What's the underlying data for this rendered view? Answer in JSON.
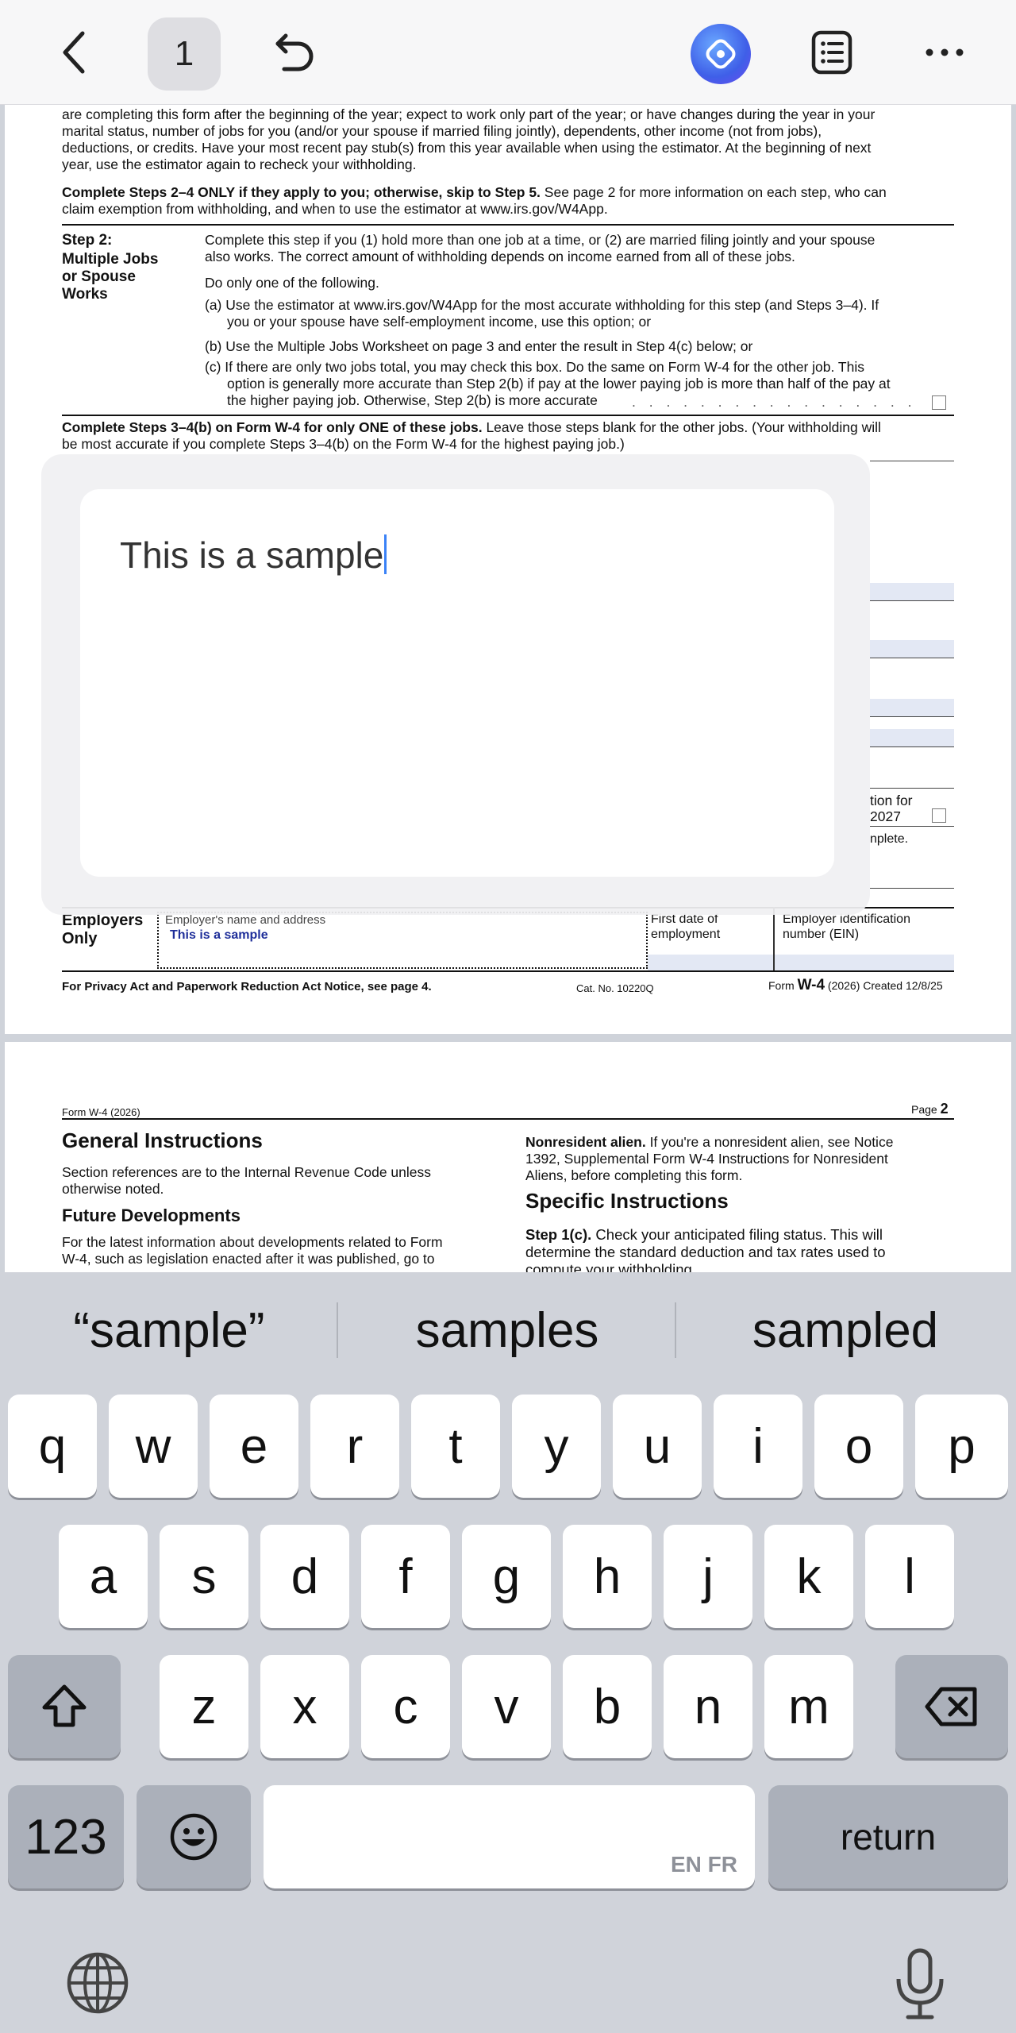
{
  "toolbar": {
    "page_number": "1"
  },
  "form_page1": {
    "intro_lines": [
      "are completing this form after the beginning of the year; expect to work only part of the year; or have changes during the year in your",
      "marital status, number of jobs for you (and/or your spouse if married filing jointly), dependents, other income (not from jobs),",
      "deductions, or credits. Have your most recent pay stub(s) from this year available when using the estimator. At the beginning of next",
      "year, use the estimator again to recheck your withholding."
    ],
    "complete_steps_bold": "Complete Steps 2–4 ONLY if they apply to you; otherwise, skip to Step 5.",
    "complete_steps_rest": " See page 2 for more information on each step, who can",
    "complete_steps_line2": "claim exemption from withholding, and when to use the estimator at www.irs.gov/W4App.",
    "step2_label": "Step 2:",
    "step2_title_lines": [
      "Multiple Jobs",
      "or Spouse",
      "Works"
    ],
    "step2_desc_lines": [
      "Complete this step if you (1) hold more than one job at a time, or (2) are married filing jointly and your spouse",
      "also works. The correct amount of withholding depends on income earned from all of these jobs."
    ],
    "do_only_one": "Do only one of the following.",
    "option_a_lines": [
      "(a) Use the estimator at www.irs.gov/W4App for the most accurate withholding for this step (and Steps 3–4). If",
      "you or your spouse have self-employment income, use this option; or"
    ],
    "option_b": "(b) Use the Multiple Jobs Worksheet on page 3 and enter the result in Step 4(c) below; or",
    "option_c_lines": [
      "(c) If there are only two jobs total, you may check this box. Do the same on Form W-4 for the other job. This",
      "option is generally more accurate than Step 2(b) if pay at the lower paying job is more than half of the pay at",
      "the higher paying job. Otherwise, Step 2(b) is more accurate"
    ],
    "steps34_bold": "Complete Steps 3–4(b) on Form W-4 for only ONE of these jobs.",
    "steps34_rest": " Leave those steps blank for the other jobs. (Your withholding will",
    "steps34_line2": "be most accurate if you complete Steps 3–4(b) on the Form W-4 for the highest paying job.)",
    "partial_right_1": "tion for",
    "partial_right_2": "2027",
    "partial_right_3": "nplete.",
    "employers_label": "Employers",
    "only_label": "Only",
    "employer_name_label": "Employer's name and address",
    "employer_name_value": "This is a sample",
    "first_date_label": "First date of",
    "first_date_label2": "employment",
    "ein_label": "Employer identification",
    "ein_label2": "number (EIN)",
    "footer_privacy": "For Privacy Act and Paperwork Reduction Act Notice, see page 4.",
    "footer_cat": "Cat. No. 10220Q",
    "footer_form_prefix": "Form ",
    "footer_form_w4": "W-4",
    "footer_form_suffix": " (2026) Created 12/8/25"
  },
  "text_edit_popup": {
    "value": "This is a sample"
  },
  "form_page2": {
    "header_left": "Form W-4 (2026)",
    "header_right_prefix": "Page ",
    "header_right_num": "2",
    "general_title": "General Instructions",
    "general_lines": [
      "Section references are to the Internal Revenue Code unless",
      "otherwise noted."
    ],
    "future_title": "Future Developments",
    "future_lines": [
      "For the latest information about developments related to Form",
      "W-4, such as legislation enacted after it was published, go to"
    ],
    "nonresident_bold": "Nonresident alien.",
    "nonresident_rest": " If you're a nonresident alien, see Notice",
    "nonresident_lines": [
      "1392, Supplemental Form W-4 Instructions for Nonresident",
      "Aliens, before completing this form."
    ],
    "specific_title": "Specific Instructions",
    "step1c_bold": "Step 1(c).",
    "step1c_rest": " Check your anticipated filing status. This will",
    "step1c_lines": [
      "determine the standard deduction and tax rates used to",
      "compute your withholding."
    ]
  },
  "keyboard": {
    "suggestions": [
      "“sample”",
      "samples",
      "sampled"
    ],
    "row1": [
      "q",
      "w",
      "e",
      "r",
      "t",
      "y",
      "u",
      "i",
      "o",
      "p"
    ],
    "row2": [
      "a",
      "s",
      "d",
      "f",
      "g",
      "h",
      "j",
      "k",
      "l"
    ],
    "row3": [
      "z",
      "x",
      "c",
      "v",
      "b",
      "n",
      "m"
    ],
    "numbers_key": "123",
    "space_lang": "EN FR",
    "return_key": "return"
  },
  "colors": {
    "accent": "#3a82f7",
    "keyboard_bg": "#d0d3da",
    "key_bg": "#ffffff",
    "mod_key_bg": "#abb0ba",
    "form_shade": "#e3e8f4",
    "employer_value": "#1f2f9a"
  },
  "icons": [
    "chevron-left-icon",
    "undo-icon",
    "ai-assistant-icon",
    "list-icon",
    "more-icon",
    "shift-icon",
    "delete-icon",
    "emoji-icon",
    "globe-icon",
    "microphone-icon",
    "checkbox-icon"
  ]
}
